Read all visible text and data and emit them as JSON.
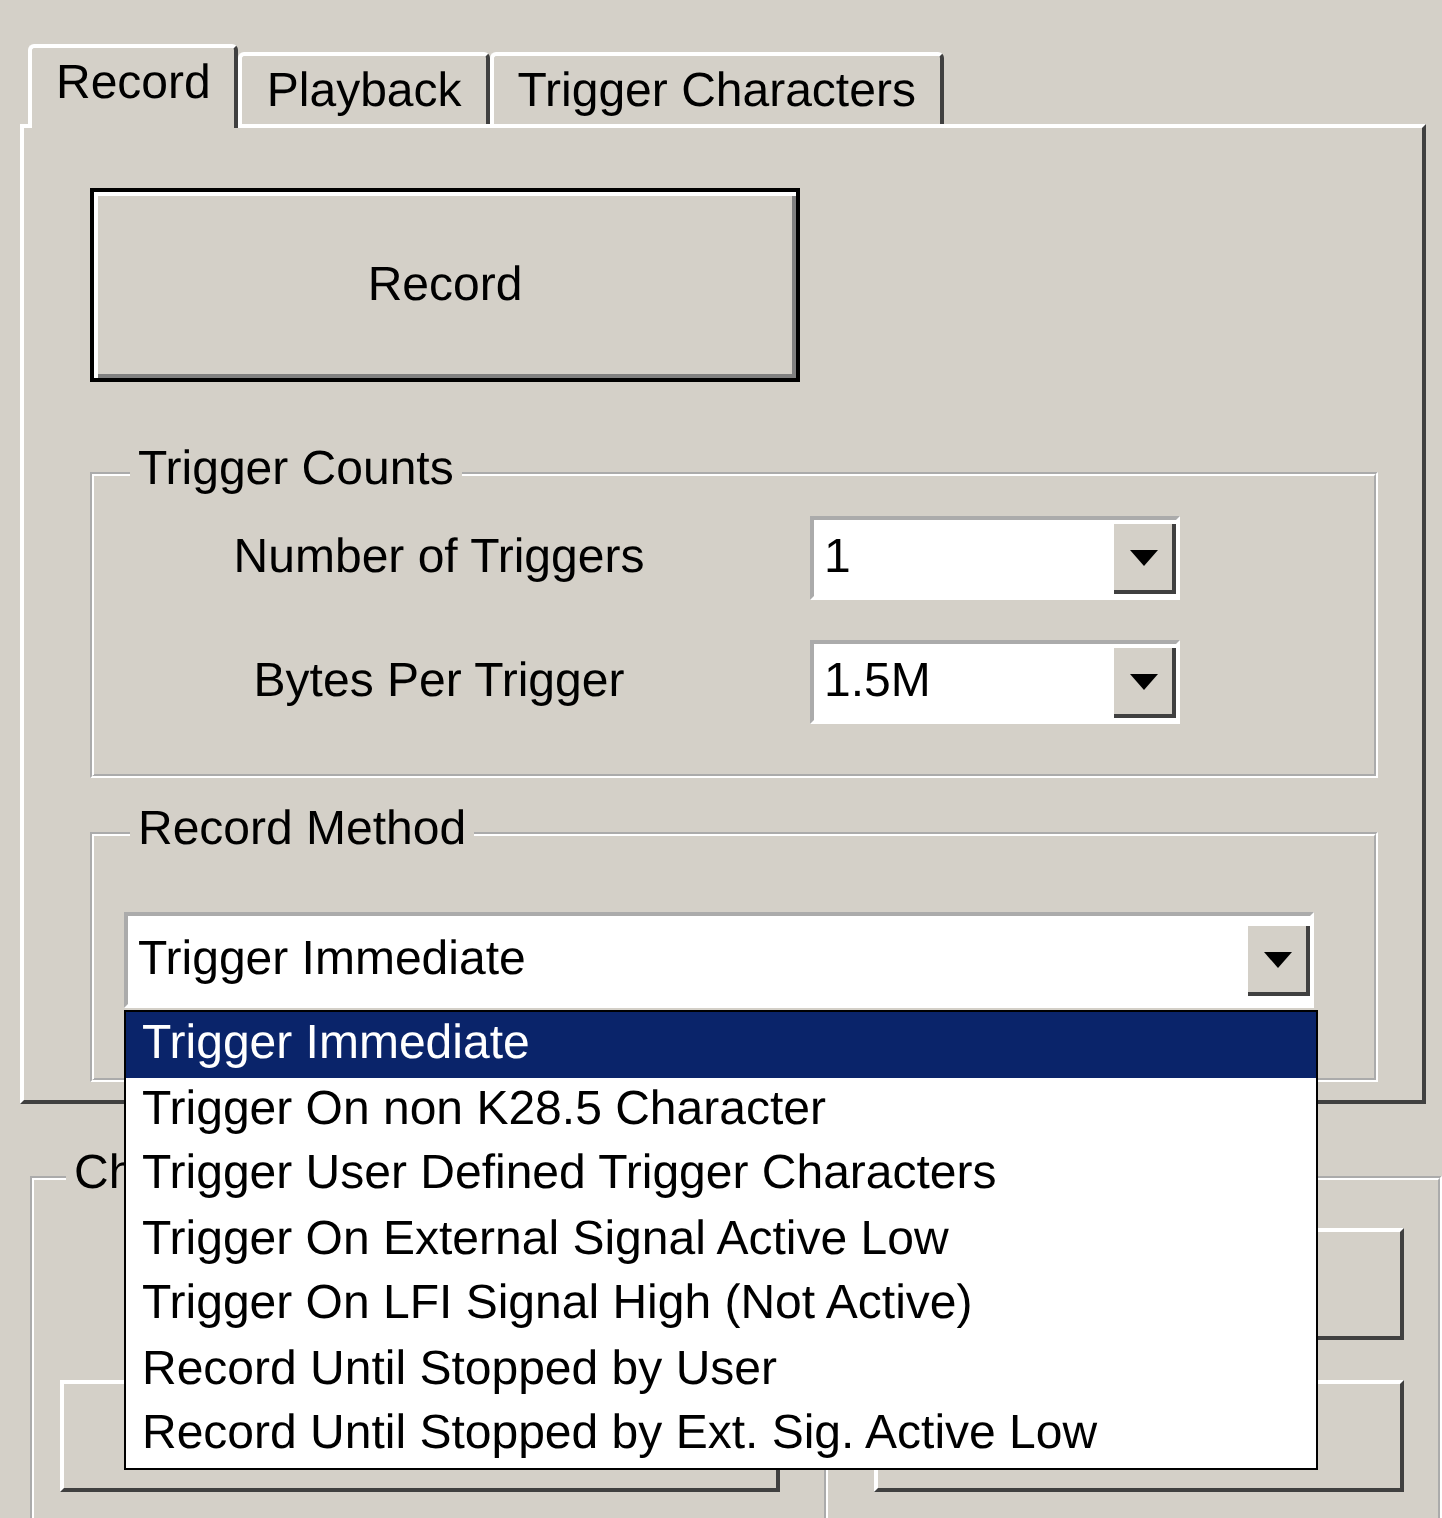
{
  "tabs": [
    {
      "label": "Record",
      "selected": true
    },
    {
      "label": "Playback",
      "selected": false
    },
    {
      "label": "Trigger Characters",
      "selected": false
    }
  ],
  "record_button": "Record",
  "trigger_counts": {
    "title": "Trigger Counts",
    "fields": [
      {
        "label": "Number of Triggers",
        "value": "1"
      },
      {
        "label": "Bytes Per Trigger",
        "value": "1.5M"
      }
    ]
  },
  "record_method": {
    "title": "Record Method",
    "value": "Trigger Immediate",
    "options": [
      {
        "label": "Trigger Immediate",
        "selected": true
      },
      {
        "label": "Trigger On non K28.5 Character",
        "selected": false
      },
      {
        "label": "Trigger User Defined Trigger Characters",
        "selected": false
      },
      {
        "label": "Trigger On External Signal Active Low",
        "selected": false
      },
      {
        "label": "Trigger On LFI Signal High (Not Active)",
        "selected": false
      },
      {
        "label": "Record Until Stopped by User",
        "selected": false
      },
      {
        "label": "Record Until Stopped by Ext. Sig. Active Low",
        "selected": false
      }
    ]
  },
  "group_2": {
    "title": "Ch"
  }
}
